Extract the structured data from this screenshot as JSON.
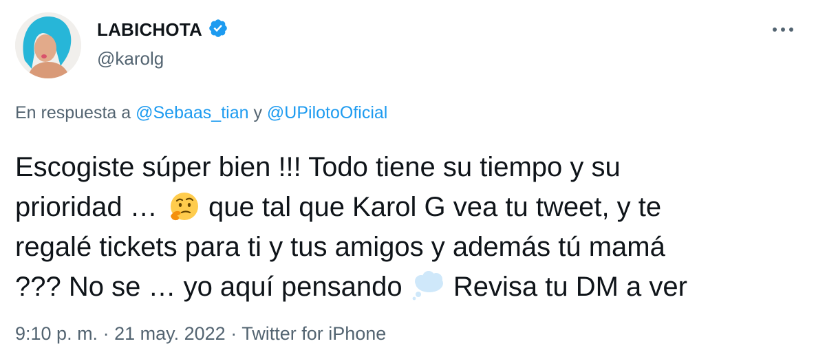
{
  "author": {
    "display_name": "LABICHOTA",
    "handle": "@karolg",
    "verified": true,
    "avatar_icon": "avatar-photo"
  },
  "more_icon": "more-options-icon",
  "reply": {
    "prefix": "En respuesta a ",
    "mention_1": "@Sebaas_tian",
    "connector": " y ",
    "mention_2": "@UPilotoOficial"
  },
  "tweet": {
    "part_1": "Escogiste súper bien !!! Todo tiene su tiempo y su\nprioridad … ",
    "emoji_1": "thinking-face-emoji",
    "part_2": " que tal que Karol G vea tu tweet, y te\nregalé tickets para ti y tus amigos y además tú mamá\n??? No se … yo aquí pensando ",
    "emoji_2": "thought-balloon-emoji",
    "part_3": " Revisa tu DM a ver"
  },
  "meta": {
    "time": "9:10 p. m.",
    "separator": " · ",
    "date": "21 may. 2022",
    "source": "Twitter for iPhone"
  },
  "colors": {
    "link": "#1d9bf0",
    "secondary_text": "#536471",
    "primary_text": "#0f1419"
  }
}
